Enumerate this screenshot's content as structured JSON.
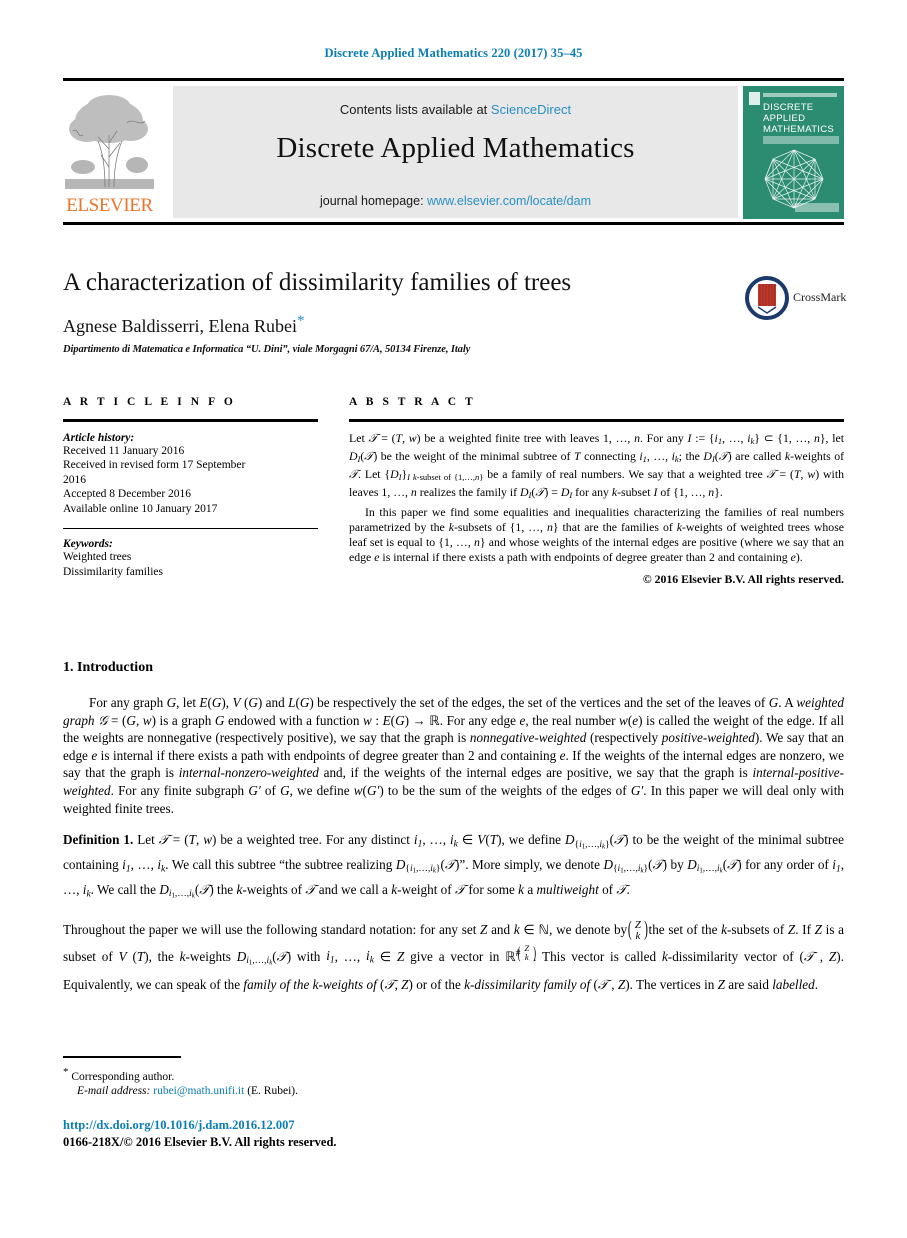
{
  "running_head": "Discrete Applied Mathematics 220 (2017) 35–45",
  "masthead": {
    "contents_prefix": "Contents lists available at ",
    "sciencedirect": "ScienceDirect",
    "journal_title": "Discrete Applied Mathematics",
    "homepage_prefix": "journal homepage: ",
    "homepage_url": "www.elsevier.com/locate/dam",
    "publisher_wordmark": "ELSEVIER",
    "cover_title_lines": [
      "DISCRETE",
      "APPLIED",
      "MATHEMATICS"
    ],
    "accent_cover": "#2c8c72",
    "accent_link": "#2a8fc4",
    "accent_elsevier": "#e8762c"
  },
  "article": {
    "title": "A characterization of dissimilarity families of trees",
    "authors": "Agnese Baldisserri, Elena Rubei",
    "corresponding_marker": "*",
    "affiliation": "Dipartimento di Matematica e Informatica “U. Dini”, viale Morgagni 67/A, 50134 Firenze, Italy",
    "crossmark_label": "CrossMark"
  },
  "article_info": {
    "heading": "A R T I C L E   I N F O",
    "history_label": "Article history:",
    "history": [
      "Received 11 January 2016",
      "Received in revised form 17 September",
      "2016",
      "Accepted 8 December 2016",
      "Available online 10 January 2017"
    ],
    "keywords_label": "Keywords:",
    "keywords": [
      "Weighted trees",
      "Dissimilarity families"
    ]
  },
  "abstract": {
    "heading": "A B S T R A C T",
    "copyright": "© 2016 Elsevier B.V. All rights reserved."
  },
  "body": {
    "section_number": "1.",
    "section_title": "Introduction",
    "definition_label": "Definition 1."
  },
  "footer": {
    "corresponding_star": "*",
    "corresponding_text": "Corresponding author.",
    "email_label": "E-mail address:",
    "email": "rubei@math.unifi.it",
    "email_owner": "(E. Rubei).",
    "doi": "http://dx.doi.org/10.1016/j.dam.2016.12.007",
    "issn_line": "0166-218X/© 2016 Elsevier B.V. All rights reserved."
  }
}
